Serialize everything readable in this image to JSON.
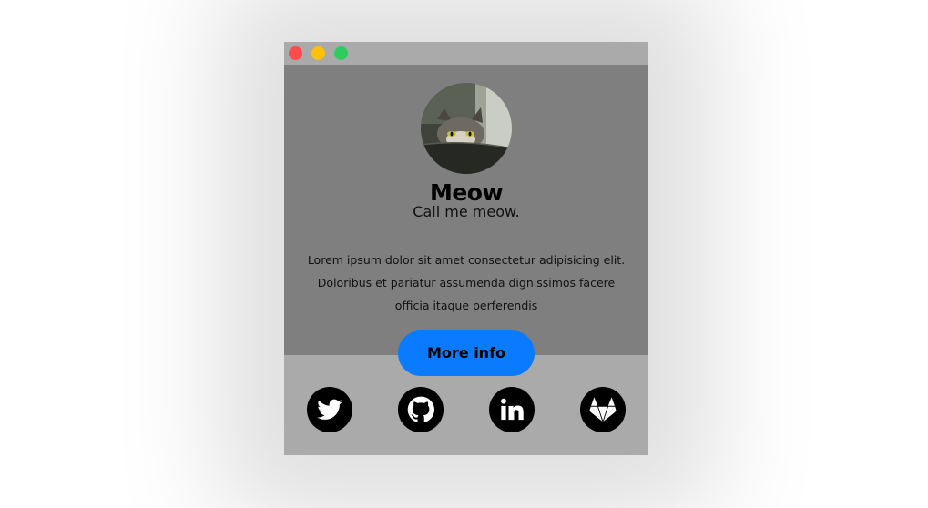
{
  "window": {
    "controls": [
      "close",
      "minimize",
      "maximize"
    ],
    "colors": {
      "close": "#ff4b4b",
      "minimize": "#ffc107",
      "maximize": "#2ecc5f"
    }
  },
  "profile": {
    "avatar_icon": "cat-photo",
    "name": "Meow",
    "tagline": "Call me meow.",
    "description": "Lorem ipsum dolor sit amet consectetur adipisicing elit. Doloribus et pariatur assumenda dignissimos facere officia itaque perferendis"
  },
  "actions": {
    "more_info_label": "More info",
    "accent": "#0a7bff"
  },
  "socials": [
    {
      "icon": "twitter-icon"
    },
    {
      "icon": "github-icon"
    },
    {
      "icon": "linkedin-icon"
    },
    {
      "icon": "gitlab-icon"
    }
  ]
}
